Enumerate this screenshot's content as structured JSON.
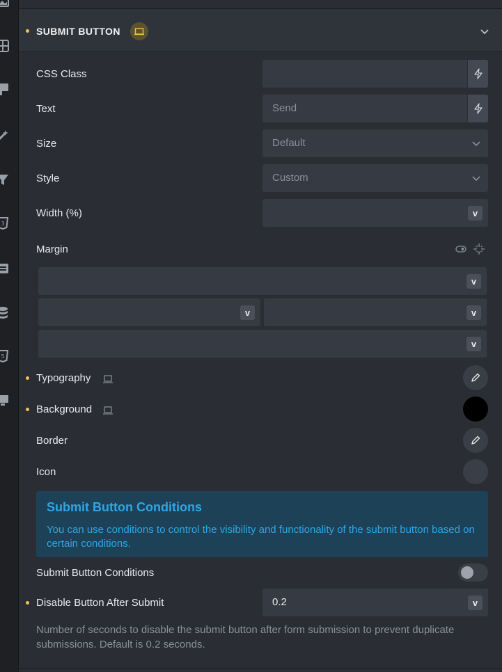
{
  "rail": {
    "icons": [
      "image-icon",
      "layout-icon",
      "flag-icon",
      "magic-wand-icon",
      "filter-icon",
      "css3-icon",
      "form-icon",
      "database-icon",
      "html5-icon",
      "display-icon"
    ]
  },
  "section": {
    "title": "SUBMIT BUTTON",
    "badge_icon": "laptop-icon",
    "collapse_icon": "chevron-down-icon"
  },
  "fields": {
    "css_class": {
      "label": "CSS Class",
      "value": ""
    },
    "text": {
      "label": "Text",
      "placeholder": "Send"
    },
    "size": {
      "label": "Size",
      "selected": "Default"
    },
    "style": {
      "label": "Style",
      "selected": "Custom"
    },
    "width": {
      "label": "Width (%)",
      "value": "",
      "unit": "v"
    },
    "margin": {
      "label": "Margin",
      "unit": "v"
    }
  },
  "controls": {
    "typography": {
      "label": "Typography"
    },
    "background": {
      "label": "Background",
      "color": "#000000"
    },
    "border": {
      "label": "Border"
    },
    "icon": {
      "label": "Icon"
    }
  },
  "info": {
    "title": "Submit Button Conditions",
    "text": "You can use conditions to control the visibility and functionality of the submit button based on certain conditions."
  },
  "conditions_toggle": {
    "label": "Submit Button Conditions",
    "enabled": false
  },
  "disable_after_submit": {
    "label": "Disable Button After Submit",
    "value": "0.2",
    "unit": "v",
    "help": "Number of seconds to disable the submit button after form submission to prevent duplicate submissions. Default is 0.2 seconds."
  },
  "colors": {
    "accent_dot": "#f2c14e",
    "info_text": "#2ea6e6",
    "info_bg": "#1d4157"
  }
}
